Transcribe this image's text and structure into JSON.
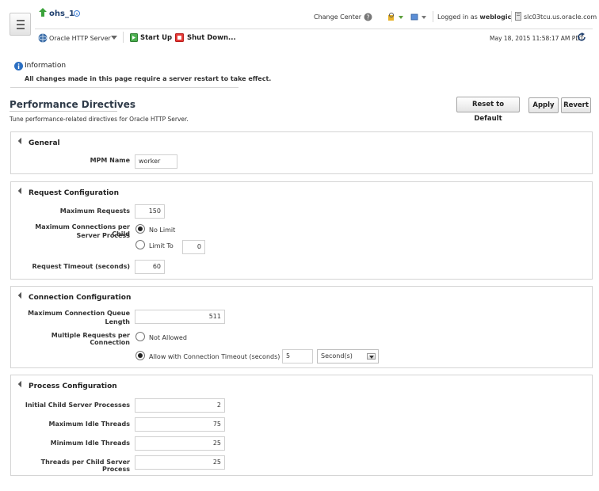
{
  "header": {
    "target_name": "ohs_1",
    "change_center": "Change Center",
    "logged_in_prefix": "Logged in as",
    "user": "weblogic",
    "host": "slc03tcu.us.oracle.com",
    "target_menu": "Oracle HTTP Server",
    "start_up": "Start Up",
    "shut_down": "Shut Down...",
    "timestamp": "May 18, 2015 11:58:17 AM PDT"
  },
  "info": {
    "title": "Information",
    "message": "All changes made in this page require a server restart to take effect."
  },
  "page": {
    "title": "Performance Directives",
    "description": "Tune performance-related directives for Oracle HTTP Server.",
    "reset_label": "Reset to Default",
    "apply_label": "Apply",
    "revert_label": "Revert"
  },
  "general": {
    "title": "General",
    "mpm_label": "MPM Name",
    "mpm_value": "worker"
  },
  "request": {
    "title": "Request Configuration",
    "max_requests_label": "Maximum Requests",
    "max_requests_value": "150",
    "max_conn_label_1": "Maximum Connections per Child",
    "max_conn_label_2": "Server Process",
    "no_limit": "No Limit",
    "limit_to": "Limit To",
    "limit_value": "0",
    "timeout_label": "Request Timeout (seconds)",
    "timeout_value": "60"
  },
  "connection": {
    "title": "Connection Configuration",
    "queue_label_1": "Maximum Connection Queue",
    "queue_label_2": "Length",
    "queue_value": "511",
    "multi_label": "Multiple Requests per Connection",
    "not_allowed": "Not Allowed",
    "allow_with": "Allow with Connection Timeout (seconds)",
    "timeout_value": "5",
    "unit": "Second(s)"
  },
  "process": {
    "title": "Process Configuration",
    "initial_label": "Initial Child Server Processes",
    "initial_value": "2",
    "max_idle_label": "Maximum Idle Threads",
    "max_idle_value": "75",
    "min_idle_label": "Minimum Idle Threads",
    "min_idle_value": "25",
    "threads_label": "Threads per Child Server Process",
    "threads_value": "25"
  }
}
